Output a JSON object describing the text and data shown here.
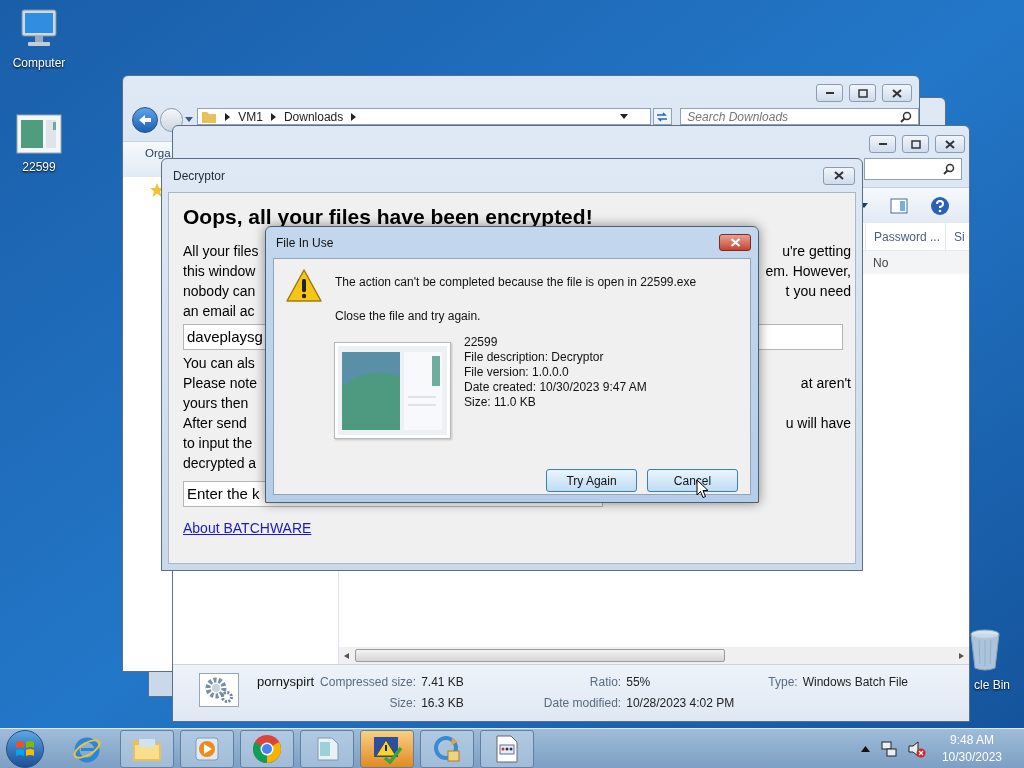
{
  "desktop_icons": [
    {
      "label": "Computer",
      "kind": "computer"
    },
    {
      "label": "22599",
      "kind": "document"
    },
    {
      "label": "cle Bin",
      "kind": "recycle-bin"
    }
  ],
  "explorer_back": {
    "address": [
      "VM1",
      "Downloads"
    ],
    "search": {
      "placeholder": "Search Downloads"
    },
    "toolbar": [
      "Orga"
    ]
  },
  "explorer_front": {
    "columns": [
      "Password ...",
      "Si"
    ],
    "rows": [
      [
        "No"
      ]
    ],
    "details": {
      "name": "pornyspirt",
      "groups": [
        [
          {
            "label": "Compressed size:",
            "value": "7.41 KB"
          },
          {
            "label": "Size:",
            "value": "16.3 KB"
          }
        ],
        [
          {
            "label": "Ratio:",
            "value": "55%"
          },
          {
            "label": "Date modified:",
            "value": "10/28/2023 4:02 PM"
          }
        ],
        [
          {
            "label": "Type:",
            "value": "Windows Batch File"
          }
        ]
      ]
    }
  },
  "decryptor": {
    "title": "Decryptor",
    "heading": "Oops, all your files have been encrypted!",
    "content": [
      {
        "kind": "line",
        "left": "All your files",
        "right": "u're getting"
      },
      {
        "kind": "line",
        "left": "this window",
        "right": "em. However,"
      },
      {
        "kind": "line",
        "left": "nobody can",
        "right": "t you need"
      },
      {
        "kind": "line",
        "left": "an email ac"
      },
      {
        "kind": "field",
        "value": "daveplaysg"
      },
      {
        "kind": "line",
        "left": "You can als"
      },
      {
        "kind": "line",
        "left": "Please note",
        "right": "at aren't"
      },
      {
        "kind": "line",
        "left": "yours then"
      },
      {
        "kind": "line",
        "left": "After send",
        "right": "u will have"
      },
      {
        "kind": "line",
        "left": "to input the"
      },
      {
        "kind": "line",
        "left": "decrypted a"
      },
      {
        "kind": "field",
        "value": "Enter the k"
      },
      {
        "kind": "link",
        "text": "About BATCHWARE"
      }
    ]
  },
  "dialog": {
    "title": "File In Use",
    "message": "The action can't be completed because the file is open in 22599.exe",
    "hint": "Close the file and try again.",
    "details": [
      "22599",
      "File description: Decryptor",
      "File version: 1.0.0.0",
      "Date created: 10/30/2023 9:47 AM",
      "Size: 11.0 KB"
    ],
    "buttons": [
      "Try Again",
      "Cancel"
    ]
  },
  "taskbar": {
    "apps": [
      {
        "kind": "browser-e",
        "running": false,
        "active": false
      },
      {
        "kind": "folder",
        "running": true,
        "active": false
      },
      {
        "kind": "media",
        "running": true,
        "active": false
      },
      {
        "kind": "chrome",
        "running": true,
        "active": false
      },
      {
        "kind": "notepad",
        "running": true,
        "active": false
      },
      {
        "kind": "warning-app",
        "running": true,
        "active": true
      },
      {
        "kind": "refresh",
        "running": true,
        "active": false
      },
      {
        "kind": "document",
        "running": true,
        "active": false
      }
    ],
    "clock": {
      "time": "9:48 AM",
      "date": "10/30/2023"
    }
  }
}
